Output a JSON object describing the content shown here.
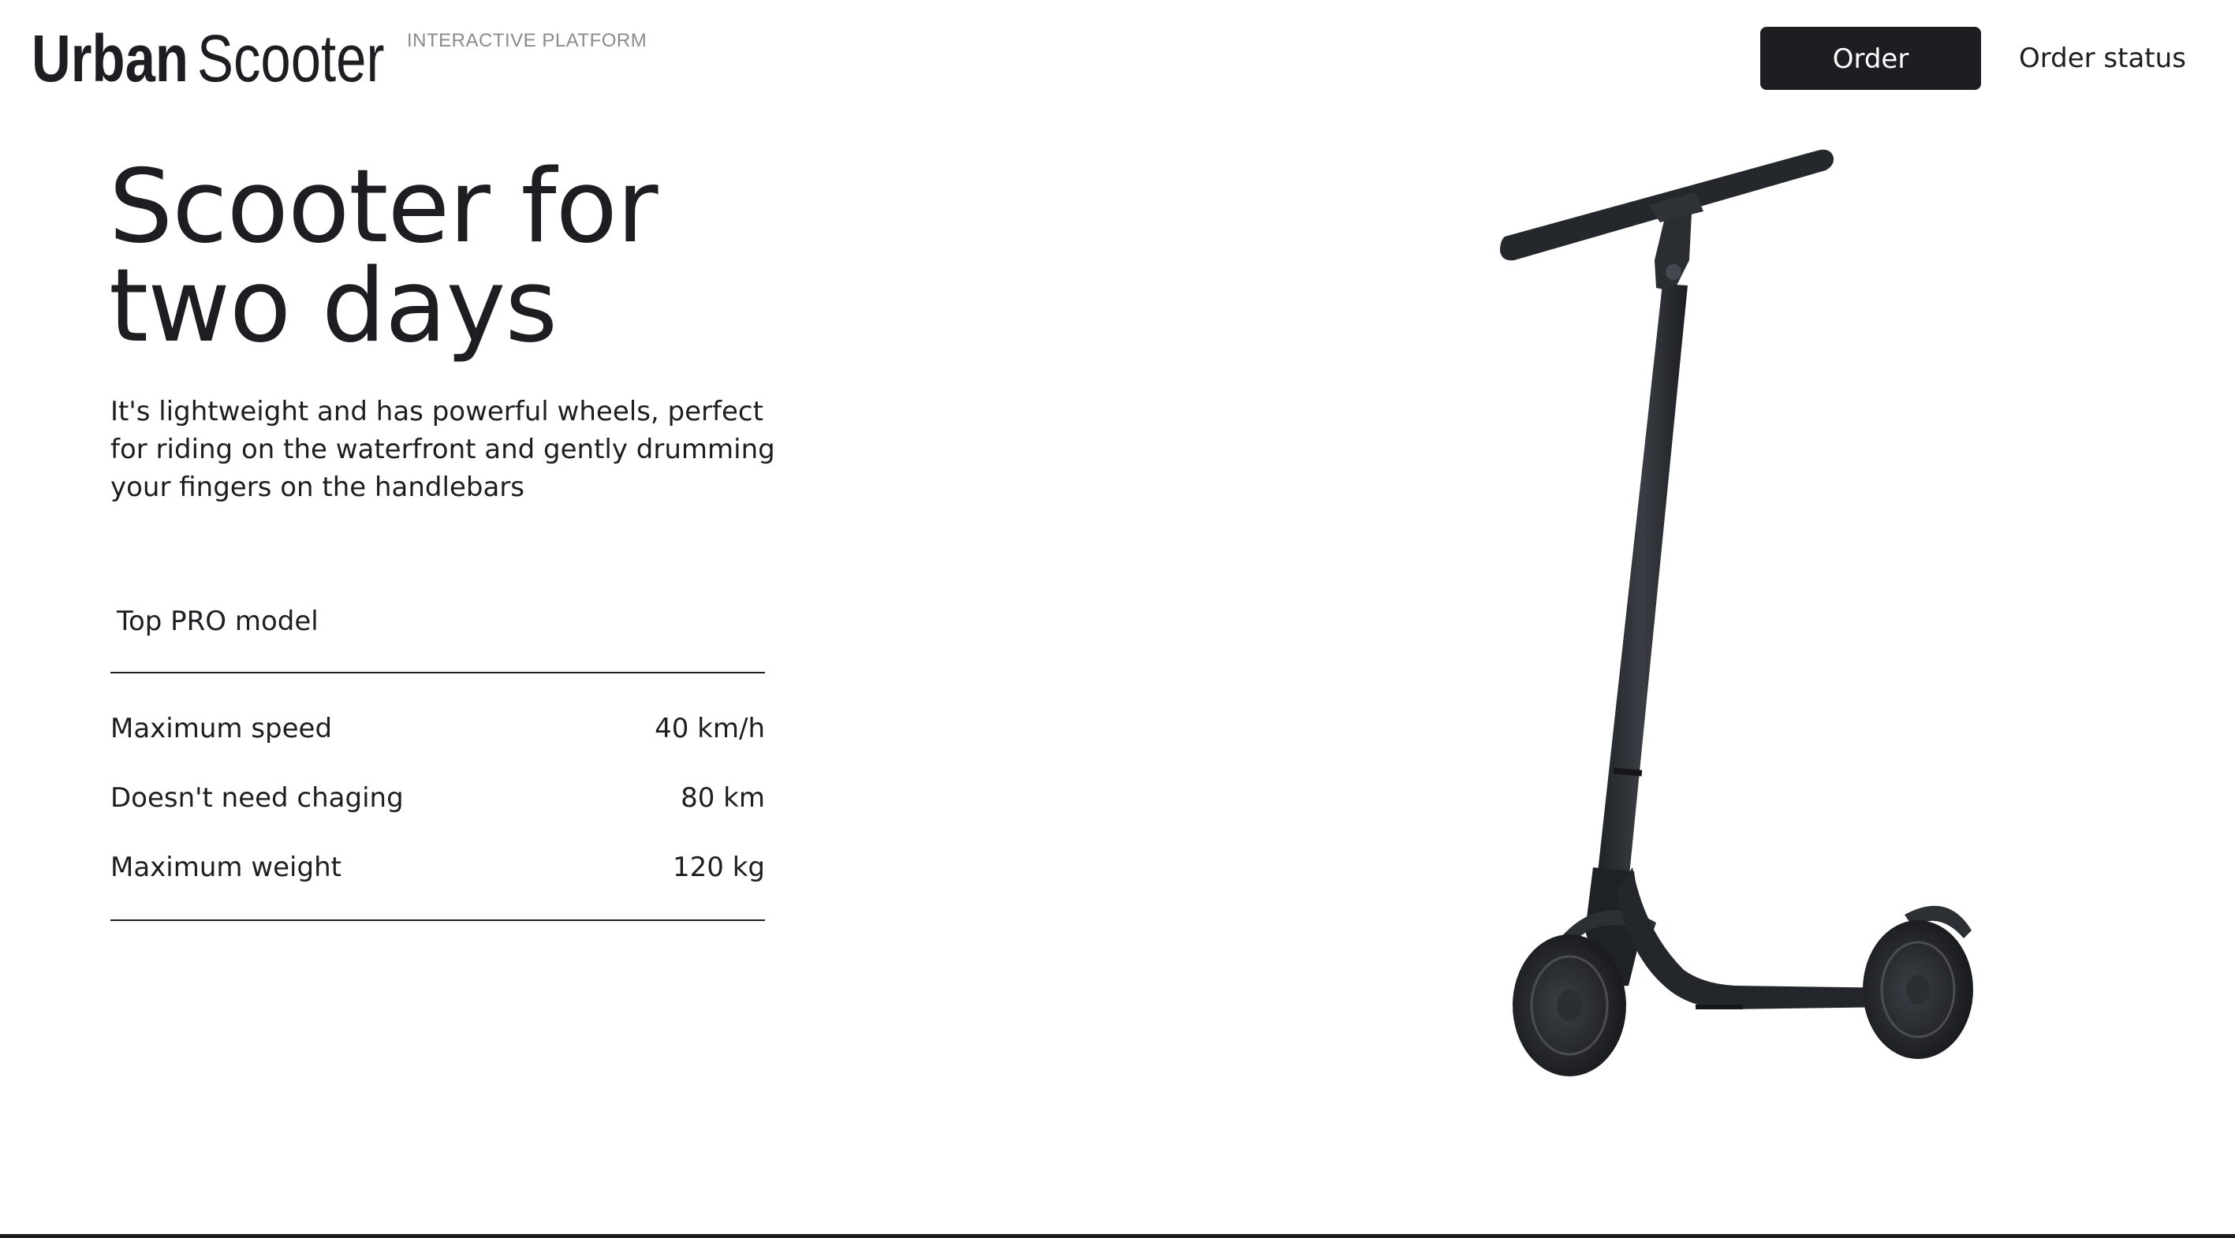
{
  "header": {
    "logo_word_1": "Urban",
    "logo_word_2": "Scooter",
    "logo_tagline": "INTERACTIVE PLATFORM",
    "order_button": "Order",
    "order_status_link": "Order status"
  },
  "hero": {
    "title_line_1": "Scooter for",
    "title_line_2": "two days",
    "description": "It's lightweight and has powerful wheels, perfect for riding on the waterfront and gently drumming your fingers on the handlebars"
  },
  "specs": {
    "heading": "Top PRO model",
    "rows": [
      {
        "label": "Maximum speed",
        "value": "40 km/h"
      },
      {
        "label": "Doesn't need chaging",
        "value": "80 km"
      },
      {
        "label": "Maximum weight",
        "value": "120 kg"
      }
    ]
  },
  "illustration": {
    "name": "scooter-image",
    "color": "#2b2e33"
  }
}
